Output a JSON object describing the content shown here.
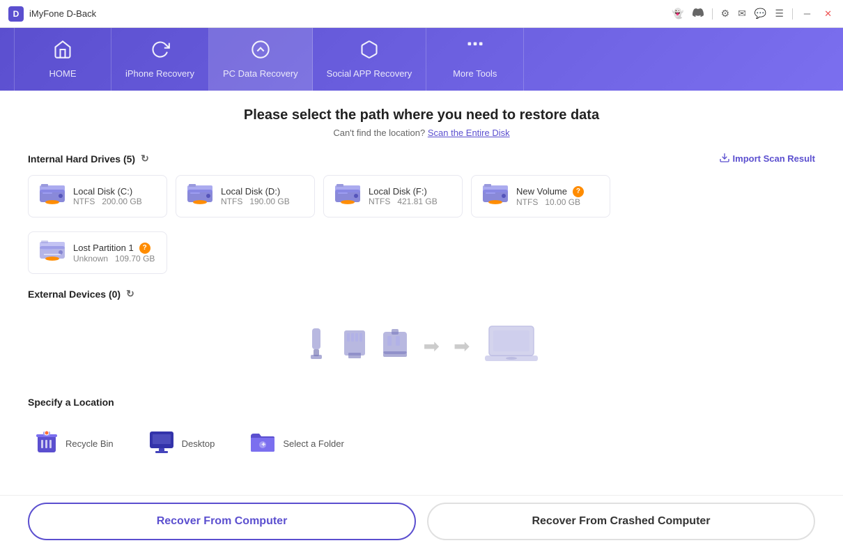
{
  "app": {
    "logo": "D",
    "title": "iMyFone D-Back"
  },
  "titlebar": {
    "icons": [
      "ghost-icon",
      "discord-icon",
      "settings-icon",
      "mail-icon",
      "chat-icon",
      "menu-icon",
      "minimize-icon",
      "close-icon"
    ]
  },
  "navbar": {
    "items": [
      {
        "id": "home",
        "label": "HOME",
        "icon": "🏠"
      },
      {
        "id": "iphone",
        "label": "iPhone Recovery",
        "icon": "🔄"
      },
      {
        "id": "pc",
        "label": "PC Data Recovery",
        "icon": "💿"
      },
      {
        "id": "social",
        "label": "Social APP Recovery",
        "icon": "📱"
      },
      {
        "id": "more",
        "label": "More Tools",
        "icon": "···"
      }
    ]
  },
  "main": {
    "title": "Please select the path where you need to restore data",
    "subtitle": "Can't find the location?",
    "subtitle_link": "Scan the Entire Disk",
    "import_label": "Import Scan Result",
    "sections": {
      "internal": {
        "label": "Internal Hard Drives (5)",
        "drives": [
          {
            "name": "Local Disk (C:)",
            "type": "NTFS",
            "size": "200.00 GB",
            "badge": false
          },
          {
            "name": "Local Disk (D:)",
            "type": "NTFS",
            "size": "190.00 GB",
            "badge": false
          },
          {
            "name": "Local Disk (F:)",
            "type": "NTFS",
            "size": "421.81 GB",
            "badge": false
          },
          {
            "name": "New Volume",
            "type": "NTFS",
            "size": "10.00 GB",
            "badge": true
          },
          {
            "name": "Lost Partition 1",
            "type": "Unknown",
            "size": "109.70 GB",
            "badge": true,
            "lost": true
          }
        ]
      },
      "external": {
        "label": "External Devices (0)"
      },
      "location": {
        "label": "Specify a Location",
        "items": [
          {
            "id": "recycle",
            "label": "Recycle Bin",
            "icon": "recycle-bin-icon"
          },
          {
            "id": "desktop",
            "label": "Desktop",
            "icon": "desktop-icon"
          },
          {
            "id": "folder",
            "label": "Select a Folder",
            "icon": "folder-icon"
          }
        ]
      }
    }
  },
  "buttons": {
    "recover_computer": "Recover From Computer",
    "recover_crashed": "Recover From Crashed Computer"
  }
}
